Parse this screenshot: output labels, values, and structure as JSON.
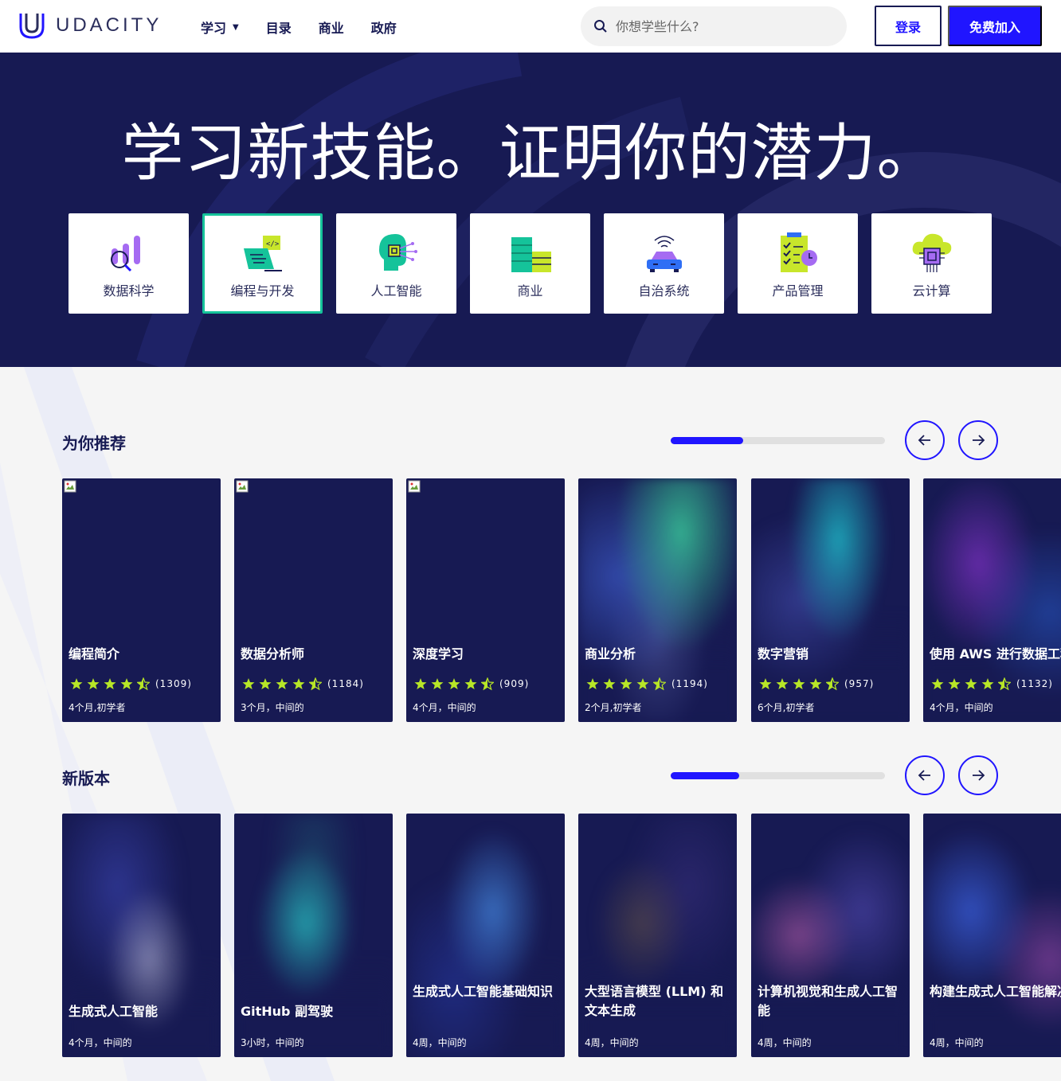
{
  "header": {
    "logo_text": "UDACITY",
    "nav": [
      {
        "label": "学习",
        "has_caret": true
      },
      {
        "label": "目录"
      },
      {
        "label": "商业"
      },
      {
        "label": "政府"
      }
    ],
    "caret": "▼",
    "search_placeholder": "你想学些什么?",
    "login_label": "登录",
    "join_label": "免费加入"
  },
  "hero": {
    "title": "学习新技能。证明你的潜力。",
    "categories": [
      {
        "label": "数据科学",
        "icon": "data-science-icon",
        "active": false
      },
      {
        "label": "编程与开发",
        "icon": "programming-icon",
        "active": true
      },
      {
        "label": "人工智能",
        "icon": "ai-icon",
        "active": false
      },
      {
        "label": "商业",
        "icon": "business-icon",
        "active": false
      },
      {
        "label": "自治系统",
        "icon": "autonomous-car-icon",
        "active": false
      },
      {
        "label": "产品管理",
        "icon": "product-management-icon",
        "active": false
      },
      {
        "label": "云计算",
        "icon": "cloud-computing-icon",
        "active": false
      }
    ]
  },
  "recommended": {
    "title": "为你推荐",
    "progress_fraction": 0.34,
    "cards": [
      {
        "title": "编程简介",
        "rating_count": "(1309)",
        "meta": "4个月,初学者",
        "image": "broken"
      },
      {
        "title": "数据分析师",
        "rating_count": "(1184)",
        "meta": "3个月，中间的",
        "image": "broken"
      },
      {
        "title": "深度学习",
        "rating_count": "(909)",
        "meta": "4个月，中间的",
        "image": "broken"
      },
      {
        "title": "商业分析",
        "rating_count": "(1194)",
        "meta": "2个月,初学者",
        "image": "glow-green"
      },
      {
        "title": "数字营销",
        "rating_count": "(957)",
        "meta": "6个月,初学者",
        "image": "glow-teal"
      },
      {
        "title": "使用 AWS 进行数据工程",
        "rating_count": "(1132)",
        "meta": "4个月，中间的",
        "image": "glow-purple"
      }
    ],
    "rating": 4.5
  },
  "new_releases": {
    "title": "新版本",
    "progress_fraction": 0.32,
    "cards": [
      {
        "title": "生成式人工智能",
        "meta": "4个月，中间的"
      },
      {
        "title": "GitHub 副驾驶",
        "meta": "3小时，中间的"
      },
      {
        "title": "生成式人工智能基础知识",
        "meta": "4周，中间的"
      },
      {
        "title": "大型语言模型 (LLM) 和文本生成",
        "meta": "4周，中间的"
      },
      {
        "title": "计算机视觉和生成人工智能",
        "meta": "4周，中间的"
      },
      {
        "title": "构建生成式人工智能解决方案",
        "meta": "4周，中间的"
      }
    ]
  },
  "colors": {
    "brand_blue": "#2015ff",
    "navy": "#171a53",
    "active_border": "#15c39a",
    "star": "#b7e627"
  }
}
